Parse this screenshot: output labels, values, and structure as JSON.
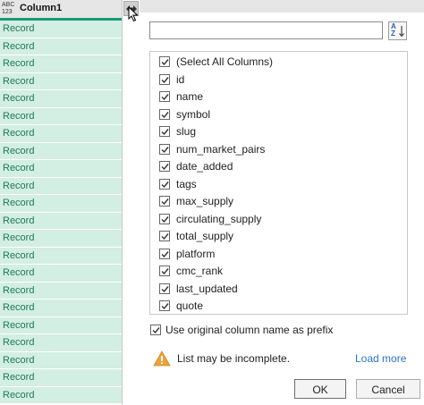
{
  "grid": {
    "type_icon_top": "ABC",
    "type_icon_bottom": "123",
    "column_title": "Column1",
    "rows": [
      "Record",
      "Record",
      "Record",
      "Record",
      "Record",
      "Record",
      "Record",
      "Record",
      "Record",
      "Record",
      "Record",
      "Record",
      "Record",
      "Record",
      "Record",
      "Record",
      "Record",
      "Record",
      "Record",
      "Record",
      "Record",
      "Record"
    ],
    "accent_color": "#1a9b74",
    "row_text_color": "#1f7a55"
  },
  "expand_button": {
    "icon": "expand-arrows-icon"
  },
  "search": {
    "value": "",
    "placeholder": ""
  },
  "sort_button": {
    "icon": "sort-az-icon",
    "label_top": "A",
    "label_bottom": "Z"
  },
  "columns": [
    {
      "label": "(Select All Columns)",
      "checked": true
    },
    {
      "label": "id",
      "checked": true
    },
    {
      "label": "name",
      "checked": true
    },
    {
      "label": "symbol",
      "checked": true
    },
    {
      "label": "slug",
      "checked": true
    },
    {
      "label": "num_market_pairs",
      "checked": true
    },
    {
      "label": "date_added",
      "checked": true
    },
    {
      "label": "tags",
      "checked": true
    },
    {
      "label": "max_supply",
      "checked": true
    },
    {
      "label": "circulating_supply",
      "checked": true
    },
    {
      "label": "total_supply",
      "checked": true
    },
    {
      "label": "platform",
      "checked": true
    },
    {
      "label": "cmc_rank",
      "checked": true
    },
    {
      "label": "last_updated",
      "checked": true
    },
    {
      "label": "quote",
      "checked": true
    }
  ],
  "prefix_option": {
    "label": "Use original column name as prefix",
    "checked": true
  },
  "warning": {
    "text": "List may be incomplete.",
    "icon": "warning-icon"
  },
  "load_more": "Load more",
  "buttons": {
    "ok": "OK",
    "cancel": "Cancel"
  }
}
